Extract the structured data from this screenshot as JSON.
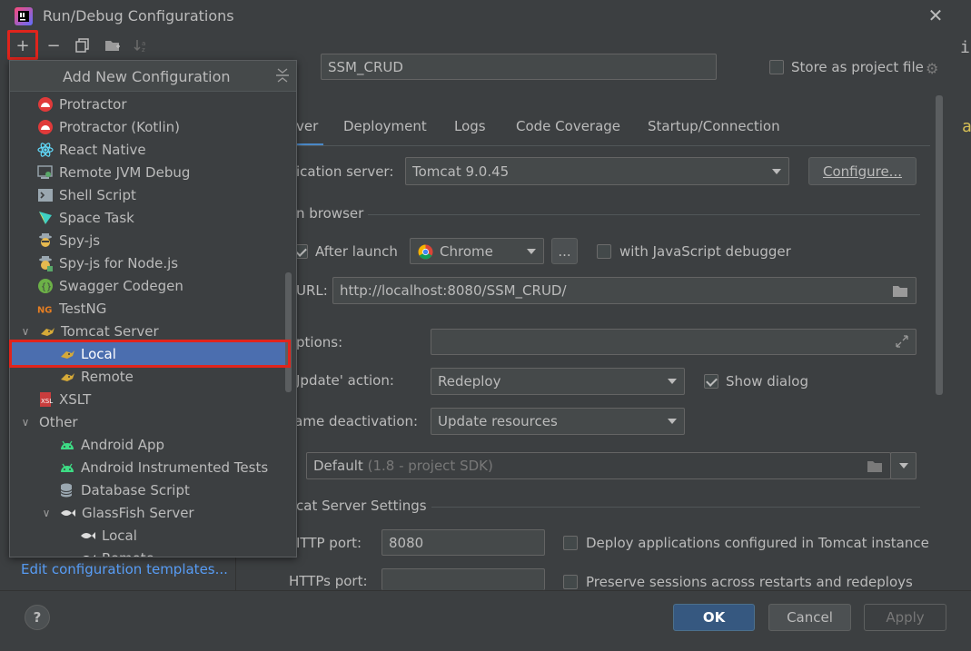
{
  "window": {
    "title": "Run/Debug Configurations"
  },
  "toolbar": {
    "add": "+",
    "remove": "−"
  },
  "popup": {
    "title": "Add New Configuration",
    "items": [
      {
        "label": "Protractor",
        "icon": "protractor-icon"
      },
      {
        "label": "Protractor (Kotlin)",
        "icon": "protractor-icon"
      },
      {
        "label": "React Native",
        "icon": "react-icon"
      },
      {
        "label": "Remote JVM Debug",
        "icon": "remote-debug-icon"
      },
      {
        "label": "Shell Script",
        "icon": "shell-icon"
      },
      {
        "label": "Space Task",
        "icon": "space-icon"
      },
      {
        "label": "Spy-js",
        "icon": "spy-icon"
      },
      {
        "label": "Spy-js for Node.js",
        "icon": "spy-icon"
      },
      {
        "label": "Swagger Codegen",
        "icon": "swagger-icon"
      },
      {
        "label": "TestNG",
        "icon": "testng-icon"
      },
      {
        "label": "Tomcat Server",
        "icon": "tomcat-icon"
      },
      {
        "label": "Local",
        "icon": "tomcat-icon"
      },
      {
        "label": "Remote",
        "icon": "tomcat-icon"
      },
      {
        "label": "XSLT",
        "icon": "xslt-icon"
      },
      {
        "label": "Other",
        "icon": ""
      },
      {
        "label": "Android App",
        "icon": "android-icon"
      },
      {
        "label": "Android Instrumented Tests",
        "icon": "android-icon"
      },
      {
        "label": "Database Script",
        "icon": "database-icon"
      },
      {
        "label": "GlassFish Server",
        "icon": "glassfish-icon"
      },
      {
        "label": "Local",
        "icon": "glassfish-icon"
      },
      {
        "label": "Remote",
        "icon": "glassfish-icon"
      }
    ]
  },
  "left": {
    "edit_templates": "Edit configuration templates..."
  },
  "form": {
    "name_label_partial": ":",
    "name_value": "SSM_CRUD",
    "store_project_file": "Store as project file",
    "tabs": [
      "ver",
      "Deployment",
      "Logs",
      "Code Coverage",
      "Startup/Connection"
    ],
    "app_server_label": "ication server:",
    "app_server_value": "Tomcat 9.0.45",
    "configure_btn": "Configure...",
    "open_browser_label": "n browser",
    "after_launch": "After launch",
    "browser_value": "Chrome",
    "dots_btn": "...",
    "js_debugger": "with JavaScript debugger",
    "url_label": "URL:",
    "url_value": "http://localhost:8080/SSM_CRUD/",
    "vm_options_label": "ptions:",
    "update_action_label": "Jpdate' action:",
    "update_action_value": "Redeploy",
    "show_dialog": "Show dialog",
    "frame_deactivation_label": "rame deactivation:",
    "frame_deactivation_value": "Update resources",
    "jre_value": "Default",
    "jre_hint": "(1.8 - project SDK)",
    "tomcat_settings_label": "cat Server Settings",
    "http_port_label": "ITTP port:",
    "http_port_value": "8080",
    "https_port_label": "HTTPs port:",
    "deploy_configured": "Deploy applications configured in Tomcat instance",
    "preserve_sessions": "Preserve sessions across restarts and redeploys"
  },
  "footer": {
    "help": "?",
    "ok": "OK",
    "cancel": "Cancel",
    "apply": "Apply"
  },
  "edge": {
    "i": "i",
    "a": "a"
  },
  "colors": {
    "accent": "#4b6eaf",
    "highlight_red": "#e0241c",
    "link": "#589df6",
    "primary_btn": "#365880"
  }
}
